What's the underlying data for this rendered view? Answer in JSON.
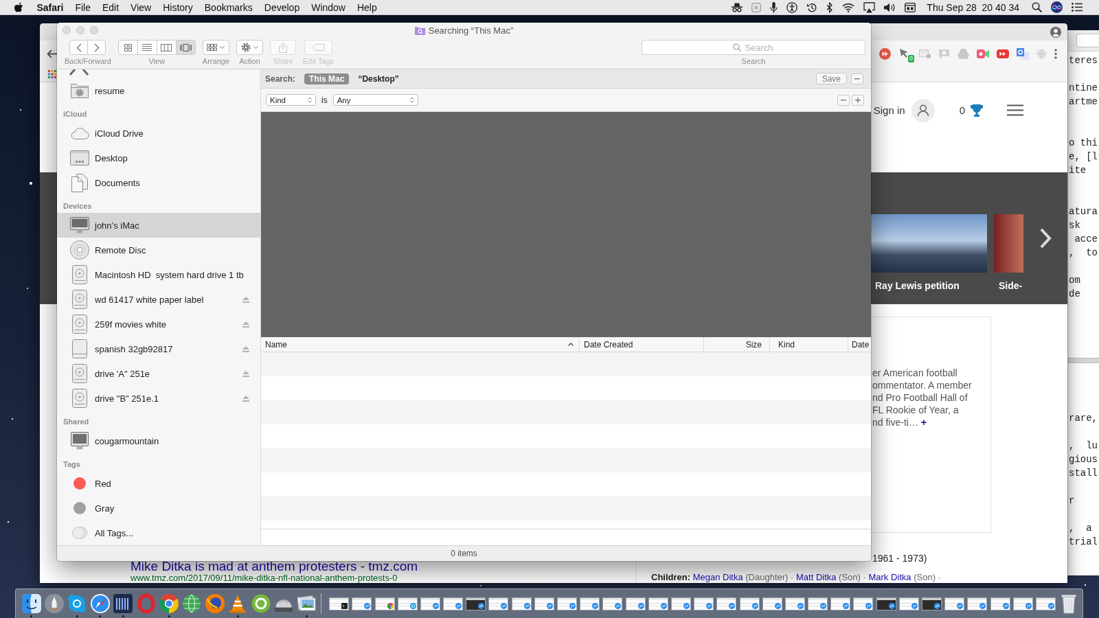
{
  "menu_bar": {
    "app_name": "Safari",
    "menus": [
      "File",
      "Edit",
      "View",
      "History",
      "Bookmarks",
      "Develop",
      "Window",
      "Help"
    ],
    "clock": "Thu Sep 28  20 40 34"
  },
  "finder": {
    "title": "Searching “This Mac”",
    "toolbar": [
      {
        "kind": "navigation",
        "label": "Back/Forward",
        "disabled": false
      },
      {
        "kind": "view",
        "label": "View",
        "disabled": false,
        "segments": [
          {
            "kind": "icons",
            "selected": false
          },
          {
            "kind": "list",
            "selected": false
          },
          {
            "kind": "columns",
            "selected": false
          },
          {
            "kind": "cover-flow",
            "selected": true
          }
        ]
      },
      {
        "kind": "arrange",
        "label": "Arrange",
        "disabled": false
      },
      {
        "kind": "action",
        "label": "Action",
        "disabled": false
      },
      {
        "kind": "share",
        "label": "Share",
        "disabled": true
      },
      {
        "kind": "tags",
        "label": "Edit Tags",
        "disabled": true
      }
    ],
    "search": {
      "placeholder": "Search",
      "label": "Search"
    },
    "sidebar": [
      {
        "items": [
          {
            "label": "resume",
            "kind": "folder",
            "selected": false
          }
        ]
      },
      {
        "title": "iCloud",
        "items": [
          {
            "label": "iCloud Drive",
            "kind": "cloud",
            "selected": false
          },
          {
            "label": "Desktop",
            "kind": "desktop",
            "selected": false
          },
          {
            "label": "Documents",
            "kind": "documents",
            "selected": false
          }
        ]
      },
      {
        "title": "Devices",
        "items": [
          {
            "label": "john’s iMac",
            "kind": "computer",
            "selected": true,
            "ejectable": false
          },
          {
            "label": "Remote Disc",
            "kind": "disc",
            "selected": false,
            "ejectable": false
          },
          {
            "label": "Macintosh HD  system hard drive 1 tb",
            "kind": "drive",
            "selected": false,
            "ejectable": false
          },
          {
            "label": "wd 61417 white paper label",
            "kind": "drive",
            "selected": false,
            "ejectable": true
          },
          {
            "label": "259f movies white",
            "kind": "drive",
            "selected": false,
            "ejectable": true
          },
          {
            "label": "spanish 32gb92817",
            "kind": "external",
            "selected": false,
            "ejectable": true
          },
          {
            "label": "drive 'A\" 251e",
            "kind": "drive",
            "selected": false,
            "ejectable": true
          },
          {
            "label": "drive \"B\" 251e.1",
            "kind": "drive",
            "selected": false,
            "ejectable": true
          }
        ]
      },
      {
        "title": "Shared",
        "items": [
          {
            "label": "cougarmountain",
            "kind": "server",
            "selected": false
          }
        ]
      },
      {
        "title": "Tags",
        "items": [
          {
            "label": "Red",
            "kind": "tag",
            "color": "#fc5b57",
            "selected": false
          },
          {
            "label": "Gray",
            "kind": "tag",
            "color": "#a1a1a3",
            "selected": false
          },
          {
            "label": "All Tags...",
            "kind": "all-tags",
            "selected": false
          }
        ]
      }
    ],
    "search_scope": {
      "label": "Search:",
      "options": [
        {
          "label": "This Mac",
          "selected": true
        },
        {
          "label": "“Desktop”",
          "selected": false
        }
      ],
      "save": "Save"
    },
    "criteria": {
      "attribute": "Kind",
      "operator": "is",
      "value": "Any"
    },
    "columns": [
      {
        "label": "Name",
        "sorted": true
      },
      {
        "label": "Date Created",
        "sorted": false
      },
      {
        "label": "Size",
        "sorted": false
      },
      {
        "label": "Kind",
        "sorted": false
      },
      {
        "label": "Date",
        "sorted": false
      }
    ],
    "status": "0 items"
  },
  "browser": {
    "extension_badge": "0",
    "sign_in": "Sign in",
    "trophy_count": "0",
    "carousel": [
      {
        "caption": "Ray Lewis petition"
      },
      {
        "caption": "Side-"
      }
    ],
    "card_lines": [
      "er American football",
      "ommentator. A member",
      "nd Pro Football Hall of",
      "FL Rookie of Year, a",
      "nd five-ti…"
    ],
    "card_more": "+",
    "result_title": "Mike Ditka is mad at anthem protesters - tmz.com",
    "result_url": "www.tmz.com/2017/09/11/mike-ditka-nfl-national-anthem-protests-0",
    "years": "1961 - 1973)",
    "children": {
      "label": "Children:",
      "entries": [
        {
          "name": "Megan Ditka",
          "relation": "(Daughter)",
          "separator": "·"
        },
        {
          "name": "Matt Ditka",
          "relation": "(Son)",
          "separator": "·"
        },
        {
          "name": "Mark Ditka",
          "relation": "(Son)",
          "separator": "·"
        }
      ]
    }
  },
  "editor": {
    "top_text": "teres\n\nntine\nartme\n\n\no thi\ne, [l\nite\n\n\natura\nsk\n acce\n,  to\n\nom\nde",
    "bottom_text": "rare,\n\n,  lu\ngious\nstall\n\nr\n\n,  a\ntrial"
  },
  "dock": {
    "apps": [
      {
        "kind": "finder",
        "running": true
      },
      {
        "kind": "launchpad",
        "running": false
      },
      {
        "kind": "skype",
        "running": true
      },
      {
        "kind": "safari",
        "running": true
      },
      {
        "kind": "bars",
        "running": true
      },
      {
        "kind": "opera",
        "running": false
      },
      {
        "kind": "chrome",
        "running": true
      },
      {
        "kind": "globe",
        "running": false
      },
      {
        "kind": "firefox",
        "running": false
      },
      {
        "kind": "vlc",
        "running": true
      },
      {
        "kind": "torrent",
        "running": false
      },
      {
        "kind": "pro",
        "running": false
      },
      {
        "kind": "preview",
        "running": true
      }
    ],
    "minimized": [
      {
        "kind": "light",
        "badge": {
          "kind": "terminal"
        }
      },
      {
        "kind": "light",
        "badge": {
          "kind": "safari"
        }
      },
      {
        "kind": "light",
        "badge": {
          "kind": "chrome"
        }
      },
      {
        "kind": "light",
        "badge": {
          "kind": "skype"
        }
      },
      {
        "kind": "light",
        "badge": {
          "kind": "safari"
        }
      },
      {
        "kind": "light",
        "badge": {
          "kind": "safari"
        }
      },
      {
        "kind": "dark",
        "badge": {
          "kind": "safari"
        }
      },
      {
        "kind": "light",
        "badge": {
          "kind": "safari"
        }
      },
      {
        "kind": "light",
        "badge": {
          "kind": "safari"
        }
      },
      {
        "kind": "light",
        "badge": {
          "kind": "safari"
        }
      },
      {
        "kind": "light",
        "badge": {
          "kind": "safari"
        }
      },
      {
        "kind": "light",
        "badge": {
          "kind": "safari"
        }
      },
      {
        "kind": "light",
        "badge": {
          "kind": "safari"
        }
      },
      {
        "kind": "light",
        "badge": {
          "kind": "safari"
        }
      },
      {
        "kind": "light",
        "badge": {
          "kind": "safari"
        }
      },
      {
        "kind": "light",
        "badge": {
          "kind": "safari"
        }
      },
      {
        "kind": "light",
        "badge": {
          "kind": "safari"
        }
      },
      {
        "kind": "light",
        "badge": {
          "kind": "safari"
        }
      },
      {
        "kind": "light",
        "badge": {
          "kind": "safari"
        }
      },
      {
        "kind": "light",
        "badge": {
          "kind": "safari"
        }
      },
      {
        "kind": "light",
        "badge": {
          "kind": "safari"
        }
      },
      {
        "kind": "light",
        "badge": {
          "kind": "safari"
        }
      },
      {
        "kind": "light",
        "badge": {
          "kind": "safari"
        }
      },
      {
        "kind": "light",
        "badge": {
          "kind": "safari"
        }
      },
      {
        "kind": "dark",
        "badge": {
          "kind": "safari"
        }
      },
      {
        "kind": "light",
        "badge": {
          "kind": "safari"
        }
      },
      {
        "kind": "dark",
        "badge": {
          "kind": "safari"
        }
      },
      {
        "kind": "light",
        "badge": {
          "kind": "safari"
        }
      },
      {
        "kind": "light",
        "badge": {
          "kind": "safari"
        }
      },
      {
        "kind": "light",
        "badge": {
          "kind": "safari"
        }
      },
      {
        "kind": "light",
        "badge": {
          "kind": "safari"
        }
      },
      {
        "kind": "light",
        "badge": {
          "kind": "safari"
        }
      }
    ]
  }
}
